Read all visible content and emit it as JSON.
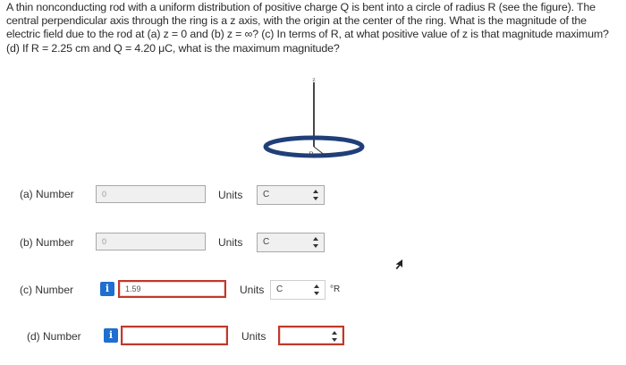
{
  "problem": {
    "text": "A thin nonconducting rod with a uniform distribution of positive charge Q is bent into a circle of radius R (see the figure). The central perpendicular axis through the ring is a z axis, with the origin at the center of the ring. What is the magnitude of the electric field due to the rod at (a) z = 0 and (b) z = ∞? (c) In terms of R, at what positive value of z is that magnitude maximum? (d) If R = 2.25 cm and Q = 4.20 μC, what is the maximum magnitude?"
  },
  "figure": {
    "axis_label": "z",
    "radius_label": "R"
  },
  "rows": [
    {
      "label": "(a)   Number",
      "value": "0",
      "units_label": "Units",
      "units_value": "C",
      "suffix": ""
    },
    {
      "label": "(b)   Number",
      "value": "0",
      "units_label": "Units",
      "units_value": "C",
      "suffix": ""
    },
    {
      "label": "(c)   Number",
      "value": "1.59",
      "units_label": "Units",
      "units_value": "C",
      "suffix": "°R",
      "info": "i"
    },
    {
      "label": "(d)   Number",
      "value": "",
      "units_label": "Units",
      "units_value": "",
      "suffix": "",
      "info": "i"
    }
  ],
  "colors": {
    "error_border": "#c0392b",
    "info_blue": "#1f6fcf"
  }
}
